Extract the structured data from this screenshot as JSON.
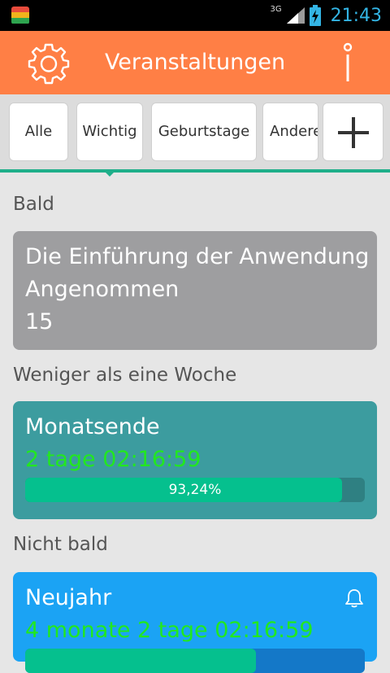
{
  "status_bar": {
    "network": "3G",
    "time": "21:43",
    "app_icon": "stacked-bars-icon"
  },
  "header": {
    "title": "Veranstaltungen",
    "left_icon": "gear-icon",
    "right_icon": "info-icon",
    "background": "#ff7f45"
  },
  "tabs": [
    {
      "label": "Alle"
    },
    {
      "label": "Wichtig"
    },
    {
      "label": "Geburtstage"
    },
    {
      "label": "Andere"
    }
  ],
  "add_tab_icon": "plus-icon",
  "sections": {
    "soon": "Bald",
    "week": "Weniger als eine Woche",
    "later": "Nicht bald"
  },
  "events": [
    {
      "title": "Die Einführung der Anwendung",
      "subtitle": "Angenommen",
      "value": "15",
      "color": "#9e9ea0"
    },
    {
      "title": "Monatsende",
      "countdown": "2 tage 02:16:59",
      "progress_label": "93,24%",
      "progress": 0.9324,
      "color": "#3c9c9f"
    },
    {
      "title": "Neujahr",
      "countdown": "4 monate 2 tage 02:16:59",
      "progress": 0.68,
      "icon": "bell-icon",
      "color": "#1ba3f4"
    }
  ],
  "countdown_color": "#22e81f",
  "accent": "#1faf8a"
}
